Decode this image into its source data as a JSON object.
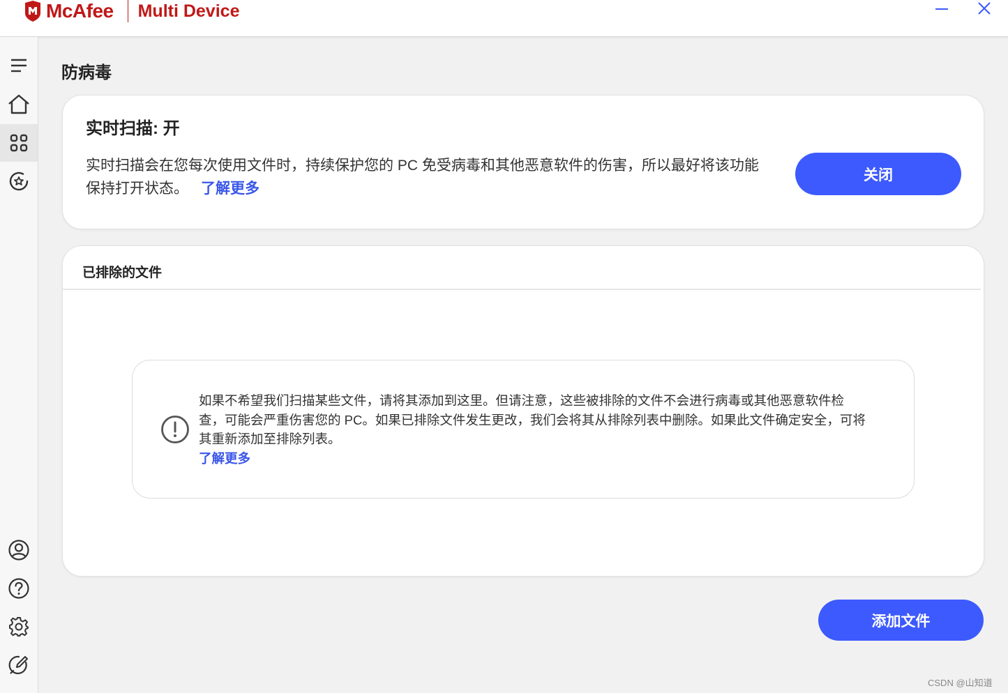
{
  "app": {
    "brand": "McAfee",
    "product": "Multi Device",
    "brand_color": "#c01818",
    "accent_color": "#3d5afe"
  },
  "window_controls": {
    "minimize_icon": "minimize-icon",
    "close_icon": "close-icon"
  },
  "sidebar": {
    "items": [
      {
        "name": "menu",
        "icon": "hamburger-icon",
        "active": false
      },
      {
        "name": "home",
        "icon": "home-icon",
        "active": false
      },
      {
        "name": "apps",
        "icon": "grid-icon",
        "active": true
      },
      {
        "name": "protection",
        "icon": "shield-star-icon",
        "active": false
      }
    ],
    "bottom_items": [
      {
        "name": "account",
        "icon": "user-icon"
      },
      {
        "name": "help",
        "icon": "help-icon"
      },
      {
        "name": "settings",
        "icon": "gear-icon"
      },
      {
        "name": "feedback",
        "icon": "feedback-icon"
      }
    ]
  },
  "page": {
    "title": "防病毒"
  },
  "realtime_card": {
    "title": "实时扫描: 开",
    "description": "实时扫描会在您每次使用文件时，持续保护您的 PC 免受病毒和其他恶意软件的伤害，所以最好将该功能保持打开状态。",
    "learn_more": "了解更多",
    "toggle_button": "关闭"
  },
  "excluded_card": {
    "title": "已排除的文件",
    "info_text": "如果不希望我们扫描某些文件，请将其添加到这里。但请注意，这些被排除的文件不会进行病毒或其他恶意软件检查，可能会严重伤害您的 PC。如果已排除文件发生更改，我们会将其从排除列表中删除。如果此文件确定安全，可将其重新添加至排除列表。",
    "learn_more": "了解更多",
    "info_icon": "info-icon"
  },
  "add_button": "添加文件",
  "watermark": "CSDN @山知道"
}
